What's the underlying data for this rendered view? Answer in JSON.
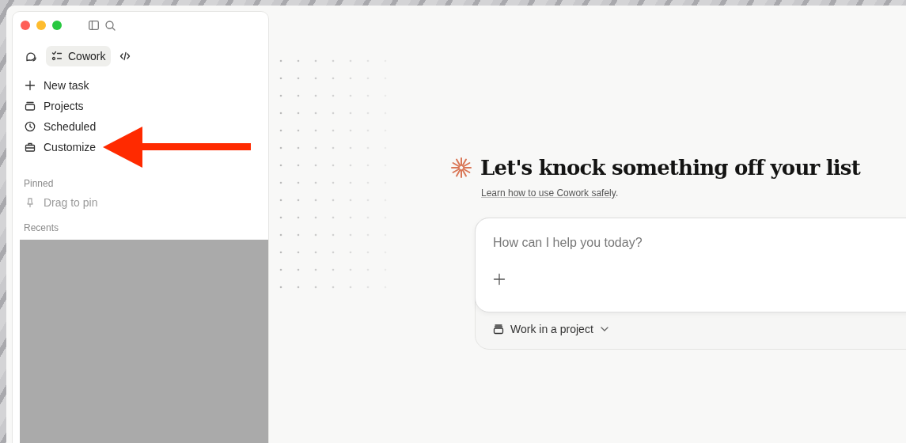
{
  "modes": [
    {
      "kind": "chat",
      "selected": false
    },
    {
      "kind": "cowork",
      "label": "Cowork",
      "selected": true
    },
    {
      "kind": "code",
      "selected": false
    }
  ],
  "nav": [
    {
      "kind": "plus",
      "label": "New task"
    },
    {
      "kind": "projects",
      "label": "Projects"
    },
    {
      "kind": "clock",
      "label": "Scheduled"
    },
    {
      "kind": "briefcase",
      "label": "Customize"
    }
  ],
  "pinned": {
    "title": "Pinned",
    "items": [
      {
        "label": "Drag to pin",
        "disabled": true
      }
    ]
  },
  "recents": {
    "title": "Recents",
    "redacted": true
  },
  "main": {
    "heading": "Let's knock something off your list",
    "link": "Learn how to use Cowork safely",
    "link_suffix": ".",
    "prompt": {
      "placeholder": "How can I help you today?"
    },
    "project_button": "Work in a project"
  },
  "annotation": {
    "kind": "arrow"
  }
}
